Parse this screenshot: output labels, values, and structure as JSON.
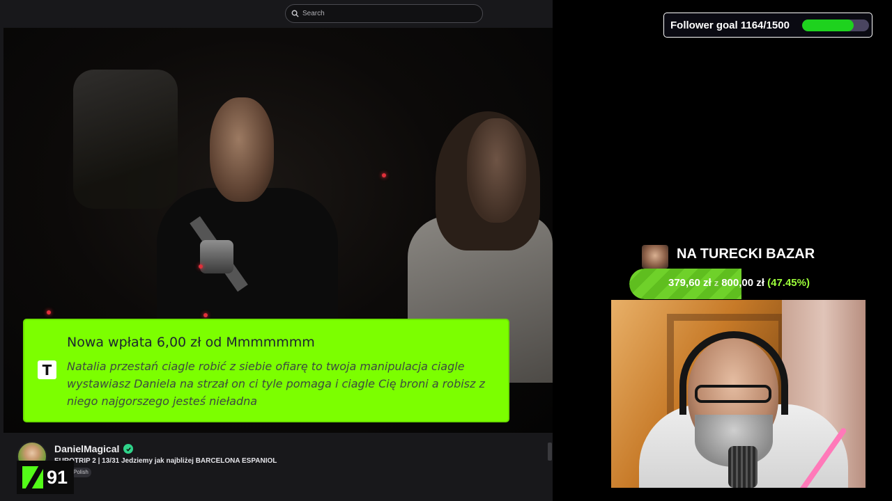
{
  "search": {
    "placeholder": "Search"
  },
  "alert": {
    "title": "Nowa wpłata 6,00 zł od Mmmmmmm",
    "message": "Natalia przestań ciagle robić z siebie ofiarę to twoja manipulacja ciagle wystawiasz Daniela na strzał on ci tyle pomaga i ciagle Cię broni a robisz z niego najgorszego jesteś nieładna",
    "icon": "T",
    "color": "#7cff00"
  },
  "channel": {
    "name": "DanielMagical",
    "title": "EUROTRIP 2 | 13/31 Jedziemy jak najbliżej BARCELONA ESPANIOL",
    "tag": "Polish",
    "verified": true
  },
  "kick_badge": {
    "count": "91",
    "color": "#53fc18"
  },
  "follower_goal": {
    "label": "Follower goal 1164/1500",
    "current": 1164,
    "target": 1500
  },
  "fundraiser": {
    "title": "NA TURECKI BAZAR",
    "raised": "379,60 zł",
    "separator": "z",
    "goal": "800,00 zł",
    "percent": "(47.45%)",
    "fraction": 0.4745
  }
}
